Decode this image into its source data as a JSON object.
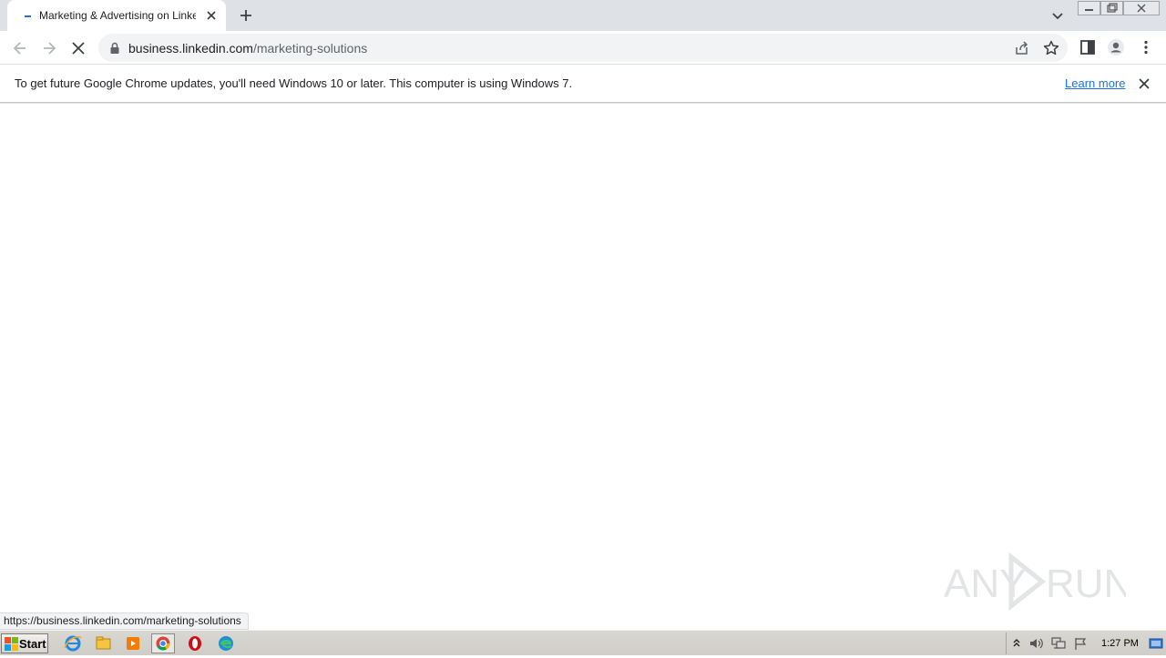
{
  "browser": {
    "tab": {
      "title": "Marketing & Advertising on LinkedIn",
      "favicon": "linkedin-loading-icon"
    },
    "address_bar": {
      "host": "business.linkedin.com",
      "path": "/marketing-solutions"
    },
    "infobar": {
      "message": "To get future Google Chrome updates, you'll need Windows 10 or later. This computer is using Windows 7.",
      "link_label": "Learn more"
    },
    "status_url": "https://business.linkedin.com/marketing-solutions",
    "icons": [
      "back-icon",
      "forward-icon",
      "stop-loading-icon",
      "lock-icon",
      "share-icon",
      "bookmark-star-icon",
      "side-panel-icon",
      "profile-icon",
      "menu-icon"
    ]
  },
  "watermark": {
    "text_left": "ANY",
    "text_right": "RUN"
  },
  "taskbar": {
    "start_label": "Start",
    "apps": [
      "internet-explorer-icon",
      "file-explorer-icon",
      "media-player-icon",
      "chrome-icon",
      "opera-icon",
      "edge-icon"
    ],
    "clock": "1:27 PM"
  },
  "colors": {
    "link": "#1a73e8",
    "tabbar_bg": "#dee1e6",
    "omnibox_bg": "#f1f3f4"
  }
}
